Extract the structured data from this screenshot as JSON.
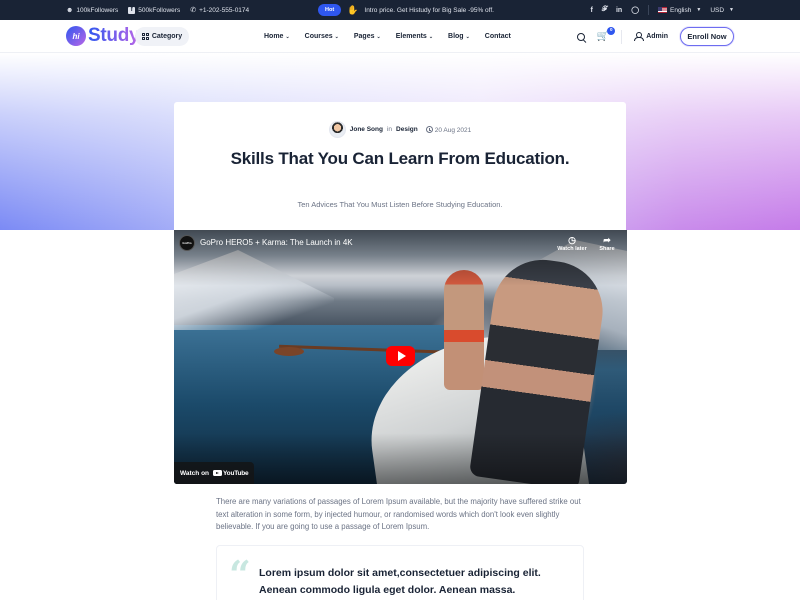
{
  "topbar": {
    "followers_1": "100kFollowers",
    "followers_2": "500kFollowers",
    "phone": "+1-202-555-0174",
    "hot_badge": "Hot",
    "promo": "Intro price. Get Histudy for Big Sale -95% off.",
    "social_icons": [
      "facebook-icon",
      "twitter-icon",
      "linkedin-icon",
      "instagram-icon"
    ],
    "language": "English",
    "currency": "USD"
  },
  "header": {
    "logo_mark": "hi",
    "logo_text": "Study",
    "category_button": "Category",
    "nav": [
      {
        "label": "Home",
        "dropdown": true
      },
      {
        "label": "Courses",
        "dropdown": true
      },
      {
        "label": "Pages",
        "dropdown": true
      },
      {
        "label": "Elements",
        "dropdown": true
      },
      {
        "label": "Blog",
        "dropdown": true
      },
      {
        "label": "Contact",
        "dropdown": false
      }
    ],
    "cart_count": "0",
    "account_label": "Admin",
    "enroll_button": "Enroll Now"
  },
  "post": {
    "author": "Jone Song",
    "in_word": "in",
    "category": "Design",
    "date": "20 Aug 2021",
    "title": "Skills That You Can Learn From Education.",
    "subtitle": "Ten Advices That You Must Listen Before Studying Education."
  },
  "video": {
    "channel_badge": "GoPro",
    "title": "GoPro HERO5 + Karma: The Launch in 4K",
    "watch_later": "Watch later",
    "share": "Share",
    "watch_on": "Watch on",
    "youtube": "YouTube"
  },
  "content": {
    "paragraph": "There are many variations of passages of Lorem Ipsum available, but the majority have suffered strike out text alteration in some form, by injected humour, or randomised words which don't look even slightly believable. If you are going to use a passage of Lorem Ipsum.",
    "quote": "Lorem ipsum dolor sit amet,consectetuer adipiscing elit. Aenean commodo ligula eget dolor. Aenean massa."
  },
  "colors": {
    "primary": "#2f57ef",
    "secondary": "#b966e7",
    "dark": "#192335",
    "body_text": "#6b7385",
    "youtube_red": "#ff0000"
  }
}
